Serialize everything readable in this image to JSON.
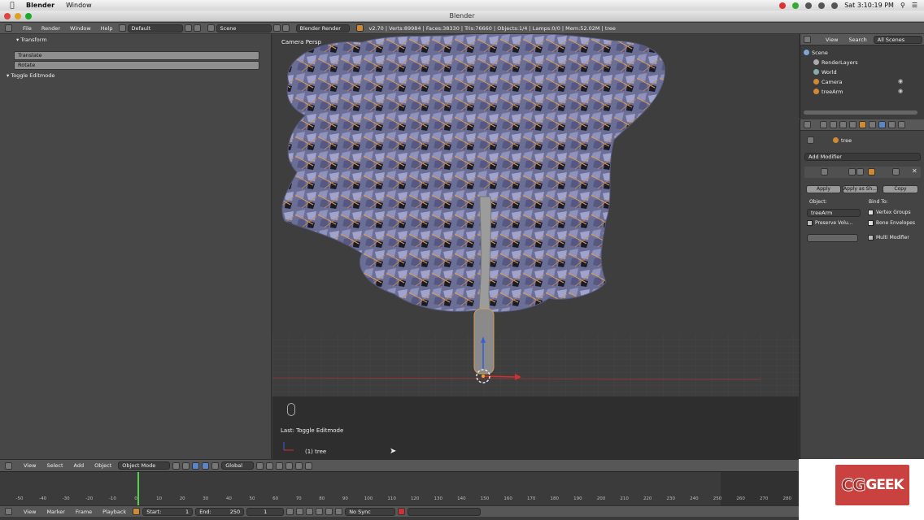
{
  "osbar": {
    "app": "Blender",
    "menu": "Window",
    "clock": "Sat 3:10:19 PM"
  },
  "window": {
    "title": "Blender"
  },
  "header": {
    "menus": [
      "File",
      "Render",
      "Window",
      "Help"
    ],
    "screen": "Default",
    "scene": "Scene",
    "engine": "Blender Render",
    "stats": "v2.70 | Verts:89984 | Faces:38330 | Tris:76660 | Objects:1/4 | Lamps:0/0 | Mem:52.02M | tree"
  },
  "toolshelf": {
    "transform_title": "Transform",
    "translate": "Translate",
    "rotate": "Rotate",
    "toggle_panel": "Toggle Editmode"
  },
  "viewport": {
    "label": "Camera Persp",
    "last_op": "Last: Toggle Editmode",
    "object": "(1) tree"
  },
  "outliner": {
    "tabs": [
      "View",
      "Search",
      "All Scenes"
    ],
    "rows": [
      "Scene",
      "RenderLayers",
      "World",
      "Camera",
      "treeArm"
    ]
  },
  "properties": {
    "object": "tree",
    "add_modifier": "Add Modifier",
    "apply": "Apply",
    "apply_shape": "Apply as Sh...",
    "copy": "Copy",
    "object_label": "Object:",
    "object_value": "treeArm",
    "bind_to": "Bind To:",
    "vertex_groups": "Vertex Groups",
    "preserve_volume": "Preserve Volu...",
    "bone_envelopes": "Bone Envelopes",
    "multi_modifier": "Multi Modifier"
  },
  "view3d_header": {
    "menus": [
      "View",
      "Select",
      "Add",
      "Object"
    ],
    "mode": "Object Mode",
    "orientation": "Global"
  },
  "timeline": {
    "menus": [
      "View",
      "Marker",
      "Frame",
      "Playback"
    ],
    "start": "Start:",
    "start_val": "1",
    "end": "End:",
    "end_val": "250",
    "current": "1",
    "sync": "No Sync",
    "ticks": [
      "-50",
      "-40",
      "-30",
      "-20",
      "-10",
      "0",
      "10",
      "20",
      "30",
      "40",
      "50",
      "60",
      "70",
      "80",
      "90",
      "100",
      "110",
      "120",
      "130",
      "140",
      "150",
      "160",
      "170",
      "180",
      "190",
      "200",
      "210",
      "220",
      "230",
      "240",
      "250",
      "260",
      "270",
      "280"
    ]
  },
  "logo": {
    "cg": "CG",
    "geek": "GEEK"
  }
}
